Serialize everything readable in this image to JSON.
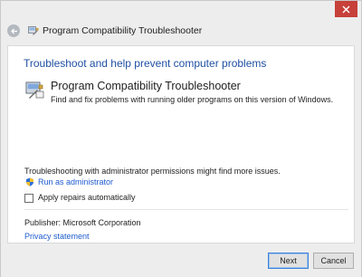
{
  "window": {
    "title": "Program Compatibility Troubleshooter"
  },
  "main": {
    "heading": "Troubleshoot and help prevent computer problems",
    "option": {
      "title": "Program Compatibility Troubleshooter",
      "description": "Find and fix problems with running older programs on this version of Windows."
    },
    "admin_note": "Troubleshooting with administrator permissions might find more issues.",
    "run_as_admin_label": "Run as administrator",
    "apply_repairs_label": "Apply repairs automatically",
    "apply_repairs_checked": false,
    "publisher": "Publisher:  Microsoft Corporation",
    "privacy_label": "Privacy statement"
  },
  "footer": {
    "next_label": "Next",
    "cancel_label": "Cancel"
  },
  "colors": {
    "link": "#1e5ccf",
    "heading": "#1f4fa3",
    "close_button": "#c7403a"
  }
}
